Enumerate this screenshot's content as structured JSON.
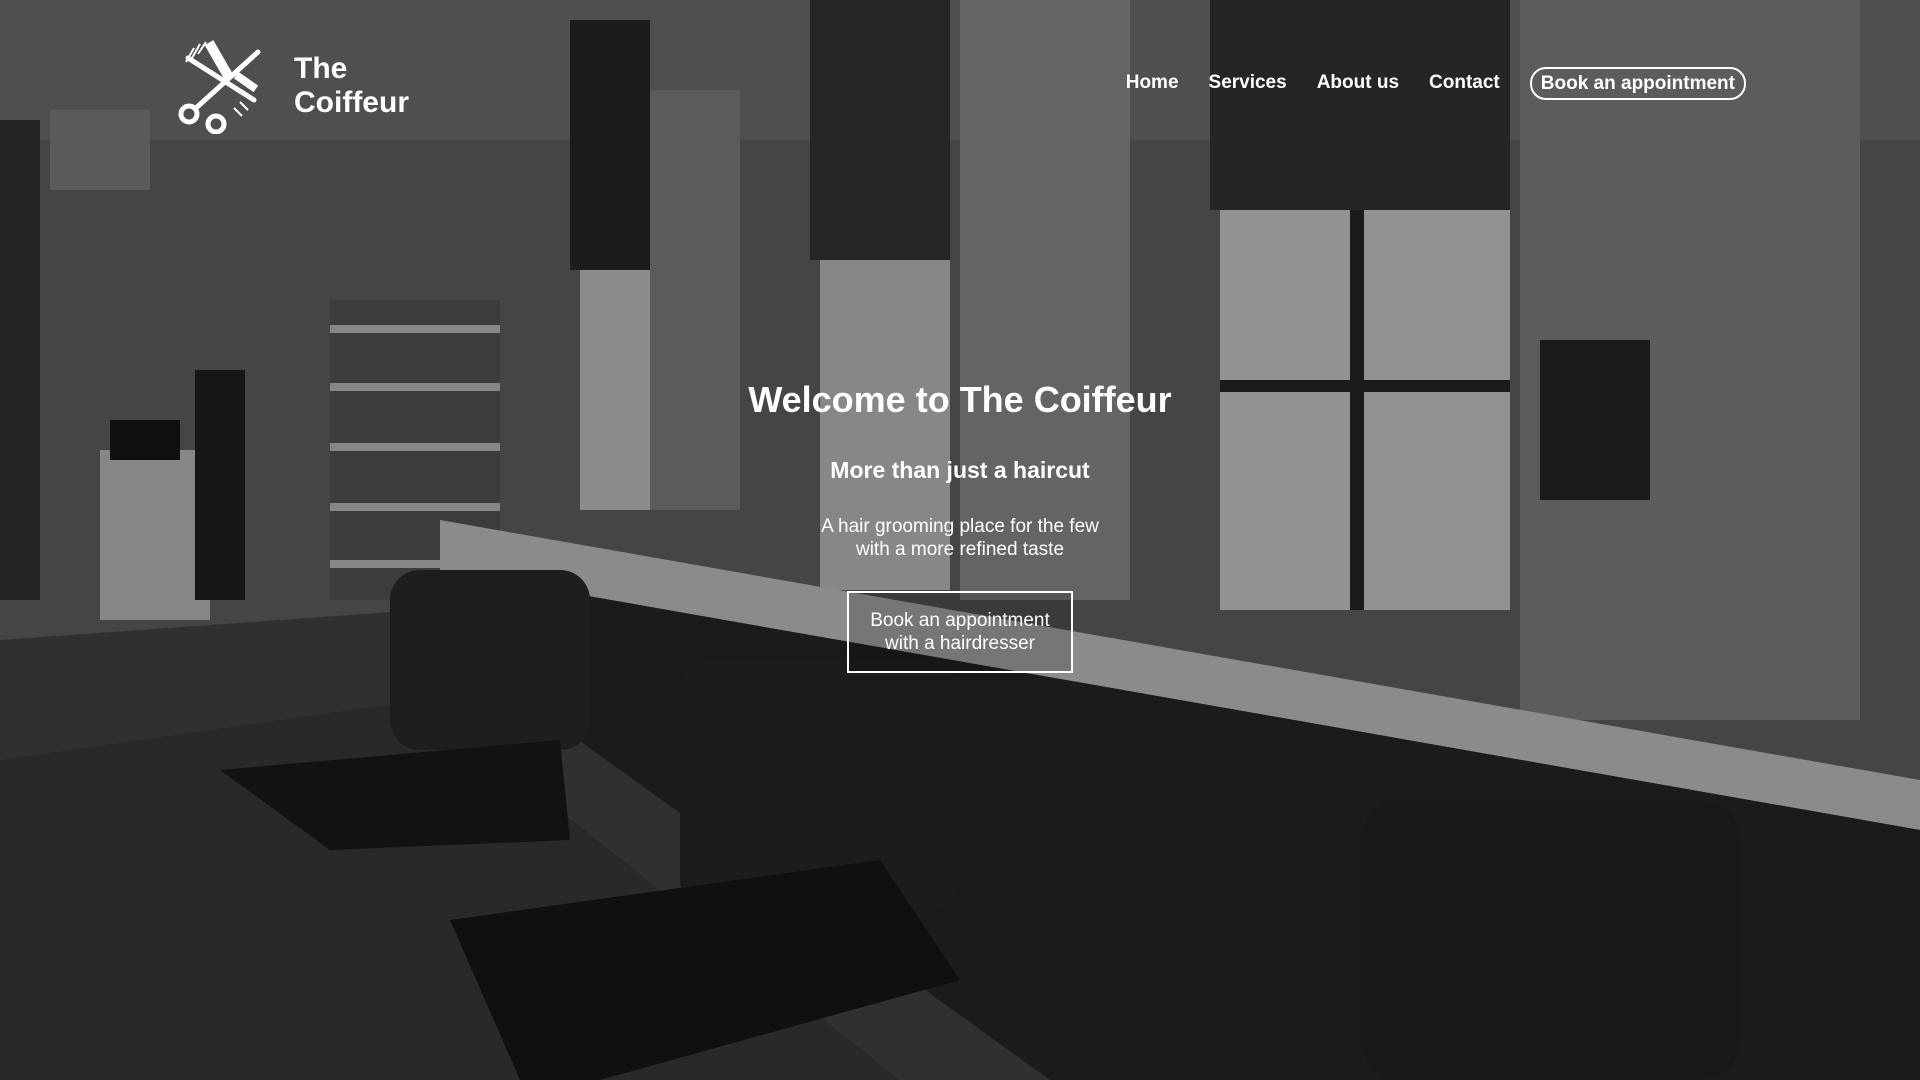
{
  "brand": {
    "line1": "The",
    "line2": "Coiffeur",
    "logo_icon": "scissors-comb-icon"
  },
  "nav": {
    "home": "Home",
    "services": "Services",
    "about": "About us",
    "contact": "Contact",
    "book": "Book an appointment"
  },
  "hero": {
    "title": "Welcome to The Coiffeur",
    "subtitle": "More than just a haircut",
    "tagline_line1": "A hair grooming place for the few",
    "tagline_line2": "with a more refined taste",
    "cta_line1": "Book an appointment",
    "cta_line2": "with a hairdresser",
    "background": "grayscale-salon-interior-photo"
  },
  "colors": {
    "text": "#ffffff",
    "overlay": "#000000"
  }
}
